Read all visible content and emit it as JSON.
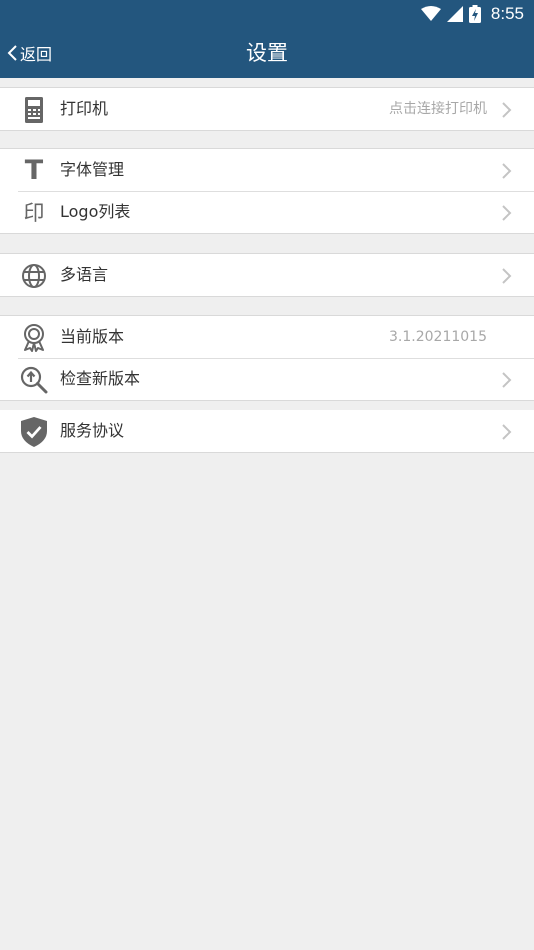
{
  "status": {
    "time": "8:55"
  },
  "nav": {
    "back_label": "返回",
    "title": "设置"
  },
  "groups": [
    {
      "items": [
        {
          "icon": "printer-icon",
          "label": "打印机",
          "value": "点击连接打印机",
          "chevron": true
        }
      ]
    },
    {
      "items": [
        {
          "icon": "font-icon",
          "label": "字体管理",
          "chevron": true
        },
        {
          "icon": "stamp-icon",
          "label": "Logo列表",
          "chevron": true
        }
      ]
    },
    {
      "items": [
        {
          "icon": "globe-icon",
          "label": "多语言",
          "chevron": true
        }
      ]
    },
    {
      "items": [
        {
          "icon": "badge-icon",
          "label": "当前版本",
          "value": "3.1.20211015",
          "chevron": false
        },
        {
          "icon": "update-search-icon",
          "label": "检查新版本",
          "chevron": true
        }
      ]
    },
    {
      "items": [
        {
          "icon": "shield-check-icon",
          "label": "服务协议",
          "chevron": true
        }
      ]
    }
  ],
  "icon_glyphs": {
    "stamp": "印",
    "font": "T"
  },
  "colors": {
    "header": "#23567e",
    "background": "#efefef",
    "icon": "#666666",
    "chevron": "#c4c4c4"
  }
}
